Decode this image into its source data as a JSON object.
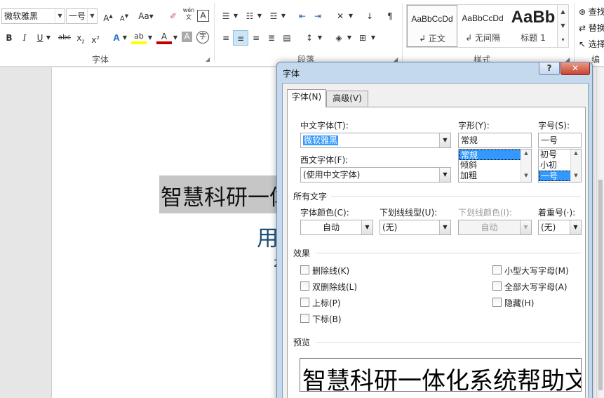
{
  "ribbon": {
    "font_name": "微软雅黑",
    "font_size": "一号",
    "font_group_label": "字体",
    "paragraph_group_label": "段落",
    "styles_group_label": "样式",
    "editing_group_label": "编辑",
    "phonetic_glyph": "wén",
    "styles": [
      {
        "sample": "AaBbCcDd",
        "name": "↲ 正文"
      },
      {
        "sample": "AaBbCcDd",
        "name": "↲ 无间隔"
      },
      {
        "sample": "AaBb",
        "name": "标题 1"
      }
    ],
    "find_label": "查找",
    "replace_label": "替换",
    "select_label": "选择"
  },
  "document": {
    "title": "智慧科研一体",
    "subtitle": "用",
    "char": "2"
  },
  "dialog": {
    "title": "字体",
    "help": "?",
    "close": "✕",
    "tabs": [
      "字体(N)",
      "高级(V)"
    ],
    "cn_font_label": "中文字体(T):",
    "cn_font_value": "微软雅黑",
    "style_label": "字形(Y):",
    "style_value": "常规",
    "style_options": [
      "常规",
      "倾斜",
      "加粗"
    ],
    "size_label": "字号(S):",
    "size_value": "一号",
    "size_options": [
      "初号",
      "小初",
      "一号"
    ],
    "west_font_label": "西文字体(F):",
    "west_font_value": "(使用中文字体)",
    "all_text_title": "所有文字",
    "color_label": "字体颜色(C):",
    "color_value": "自动",
    "underline_label": "下划线线型(U):",
    "underline_value": "(无)",
    "underline_color_label": "下划线颜色(I):",
    "underline_color_value": "自动",
    "emphasis_label": "着重号(·):",
    "emphasis_value": "(无)",
    "effects_title": "效果",
    "effects_left": [
      "删除线(K)",
      "双删除线(L)",
      "上标(P)",
      "下标(B)"
    ],
    "effects_right": [
      "小型大写字母(M)",
      "全部大写字母(A)",
      "隐藏(H)"
    ],
    "preview_title": "预览",
    "preview_text": "智慧科研一体化系统帮助文"
  }
}
